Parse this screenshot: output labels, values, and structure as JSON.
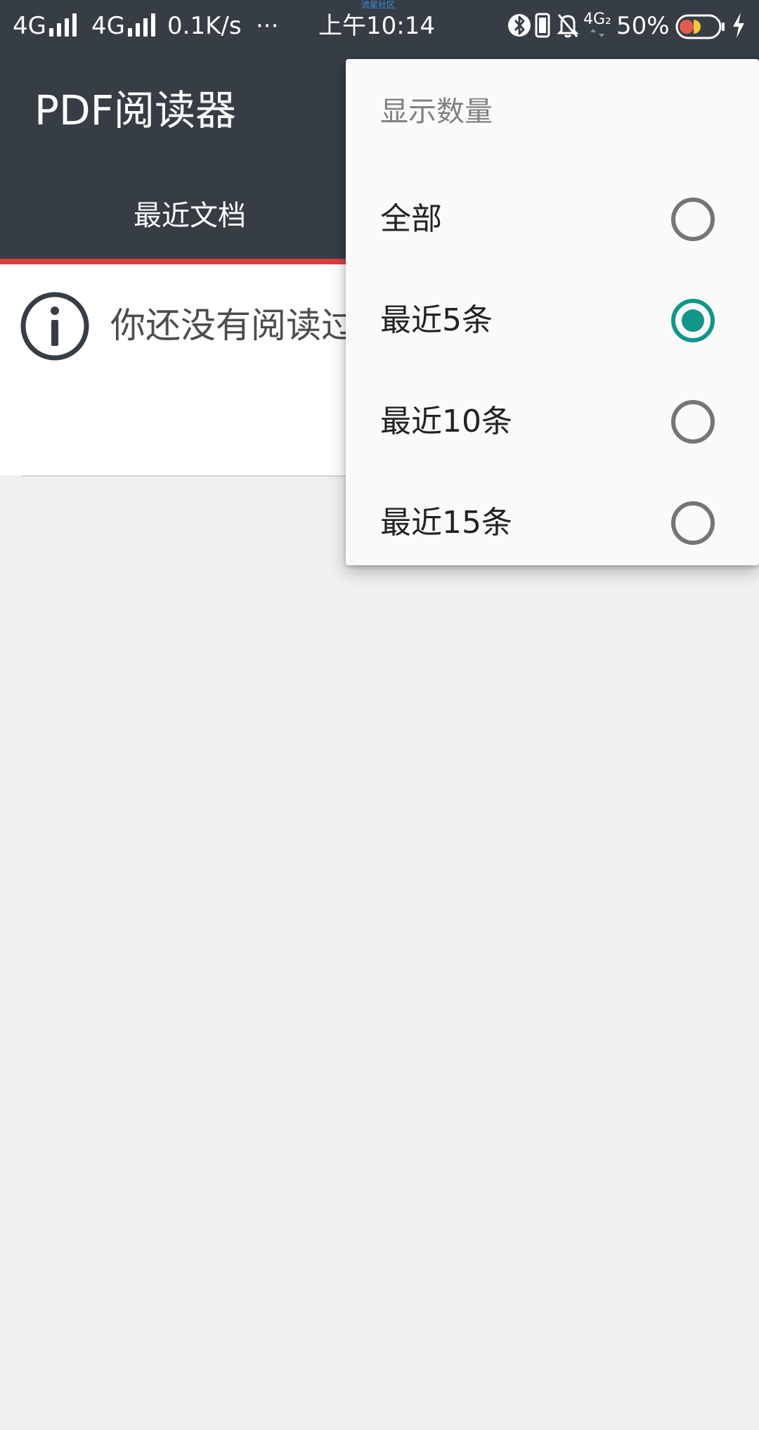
{
  "status_bar": {
    "carrier1": "4G",
    "carrier2": "4G",
    "speed": "0.1K/s",
    "more": "···",
    "watermark": "流星社区",
    "time": "上午10:14",
    "network2": "4G₂",
    "battery_percent": "50%"
  },
  "app": {
    "title": "PDF阅读器",
    "tabs": [
      {
        "label": "最近文档",
        "selected": true
      }
    ],
    "accent_color": "#d84040",
    "toolbar_color": "#373d45"
  },
  "content": {
    "empty_message": "你还没有阅读过"
  },
  "popup": {
    "title": "显示数量",
    "options": [
      {
        "label": "全部",
        "selected": false
      },
      {
        "label": "最近5条",
        "selected": true
      },
      {
        "label": "最近10条",
        "selected": false
      },
      {
        "label": "最近15条",
        "selected": false
      }
    ],
    "radio_checked_color": "#11968a"
  }
}
